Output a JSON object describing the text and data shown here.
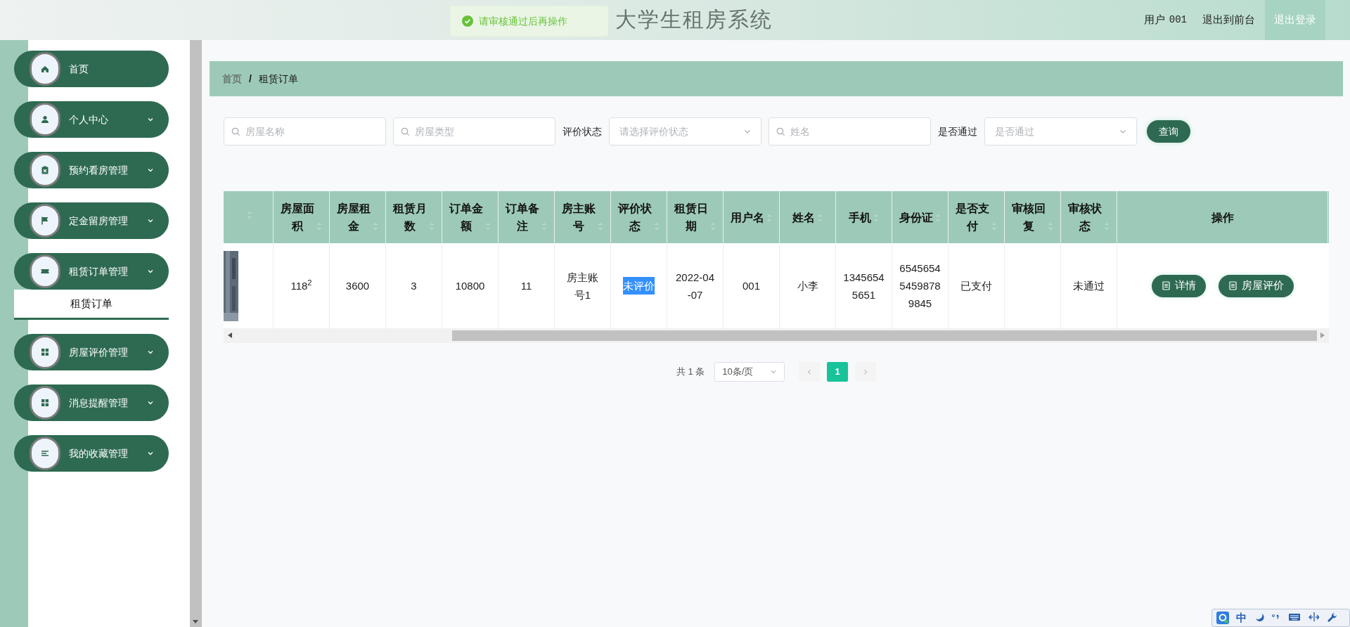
{
  "header": {
    "title": "大学生租房系统",
    "toast": {
      "kind": "success",
      "text": "请审核通过后再操作"
    },
    "user_label": "用户",
    "user_name": "001",
    "links": [
      {
        "label": "退出到前台",
        "kind": "link"
      },
      {
        "label": "退出登录",
        "kind": "button"
      }
    ]
  },
  "sidebar": {
    "items": [
      {
        "label": "首页",
        "kind": "home",
        "expandable": false
      },
      {
        "label": "个人中心",
        "kind": "person",
        "expandable": true
      },
      {
        "label": "预约看房管理",
        "kind": "clipboard",
        "expandable": true
      },
      {
        "label": "定金留房管理",
        "kind": "flag",
        "expandable": true
      },
      {
        "label": "租赁订单管理",
        "kind": "ticket",
        "expandable": true,
        "children": [
          {
            "label": "租赁订单",
            "selected": true
          }
        ]
      },
      {
        "label": "房屋评价管理",
        "kind": "grid",
        "expandable": true
      },
      {
        "label": "消息提醒管理",
        "kind": "grid",
        "expandable": true
      },
      {
        "label": "我的收藏管理",
        "kind": "list",
        "expandable": true
      }
    ]
  },
  "breadcrumb": {
    "separator": "/",
    "items": [
      {
        "label": "首页",
        "current": false
      },
      {
        "label": "租赁订单",
        "current": true
      }
    ]
  },
  "filters": [
    {
      "kind": "search",
      "placeholder": "房屋名称"
    },
    {
      "kind": "search",
      "placeholder": "房屋类型"
    },
    {
      "kind": "label",
      "text": "评价状态"
    },
    {
      "kind": "select",
      "placeholder": "请选择评价状态"
    },
    {
      "kind": "search",
      "placeholder": "姓名"
    },
    {
      "kind": "label",
      "text": "是否通过"
    },
    {
      "kind": "select",
      "placeholder": "是否通过"
    }
  ],
  "search_button": "查询",
  "table": {
    "columns": [
      {
        "sortable": true
      },
      {
        "label": "房屋面积",
        "sortable": true
      },
      {
        "label": "房屋租金",
        "sortable": true
      },
      {
        "label": "租赁月数",
        "sortable": true
      },
      {
        "label": "订单金额",
        "sortable": true
      },
      {
        "label": "订单备注",
        "sortable": true
      },
      {
        "label": "房主账号",
        "sortable": true
      },
      {
        "label": "评价状态",
        "sortable": true
      },
      {
        "label": "租赁日期",
        "sortable": true
      },
      {
        "label": "用户名",
        "sortable": true
      },
      {
        "label": "姓名",
        "sortable": true
      },
      {
        "label": "手机",
        "sortable": true
      },
      {
        "label": "身份证",
        "sortable": true
      },
      {
        "label": "是否支付",
        "sortable": true
      },
      {
        "label": "审核回复",
        "sortable": true
      },
      {
        "label": "审核状态",
        "sortable": true
      },
      {
        "label": "操作",
        "sortable": false
      }
    ],
    "rows": [
      {
        "cells": [
          {
            "kind": "picture"
          },
          {
            "kind": "text",
            "text": "118$^{2}$",
            "highlighted": false
          },
          {
            "kind": "text",
            "text": "3600",
            "highlighted": false
          },
          {
            "kind": "text",
            "text": "3",
            "highlighted": false
          },
          {
            "kind": "text",
            "text": "10800",
            "highlighted": false
          },
          {
            "kind": "text",
            "text": "11",
            "highlighted": false
          },
          {
            "kind": "text",
            "text": "房主账号1",
            "highlighted": false
          },
          {
            "kind": "text",
            "text": "未评价",
            "highlighted": true
          },
          {
            "kind": "text",
            "text": "2022-04-07",
            "highlighted": false
          },
          {
            "kind": "text",
            "text": "001",
            "highlighted": false
          },
          {
            "kind": "text",
            "text": "小李",
            "highlighted": false
          },
          {
            "kind": "text",
            "text": "13456545651",
            "highlighted": false
          },
          {
            "kind": "text",
            "text": "654565454598789845",
            "highlighted": false
          },
          {
            "kind": "text",
            "text": "已支付",
            "highlighted": false
          },
          {
            "kind": "empty"
          },
          {
            "kind": "text",
            "text": "未通过",
            "highlighted": false
          }
        ],
        "actions": [
          "详情",
          "房屋评价"
        ]
      }
    ]
  },
  "pagination": {
    "total": "共 1 条",
    "page_size": "10条/页",
    "prev": {
      "disabled": true
    },
    "next": {
      "disabled": true
    },
    "pages": [
      {
        "label": "1",
        "selected": true
      }
    ]
  },
  "ime_bar": {
    "items": [
      {
        "kind": "logo"
      },
      {
        "kind": "text",
        "text": "中"
      },
      {
        "kind": "moon"
      },
      {
        "kind": "punct"
      },
      {
        "kind": "keyboard"
      },
      {
        "kind": "split"
      },
      {
        "kind": "wrench"
      }
    ]
  }
}
